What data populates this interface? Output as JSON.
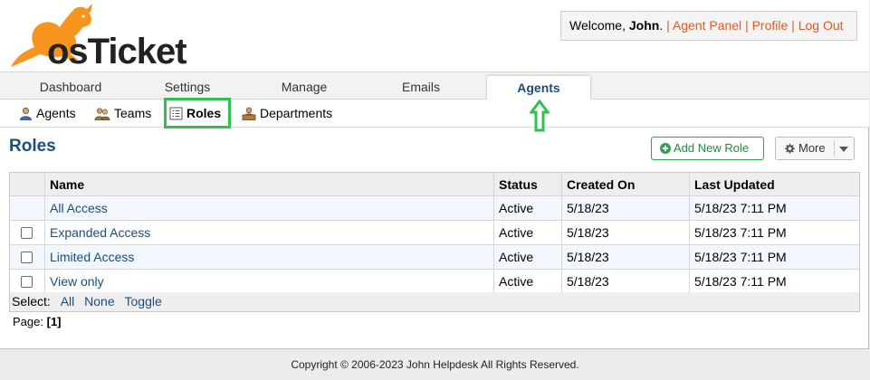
{
  "brand": {
    "logo_text": "osTicket"
  },
  "user_bar": {
    "welcome_prefix": "Welcome, ",
    "user_name": "John",
    "welcome_suffix": ".",
    "separator": "|",
    "links": [
      "Agent Panel",
      "Profile",
      "Log Out"
    ]
  },
  "nav": {
    "tabs": [
      "Dashboard",
      "Settings",
      "Manage",
      "Emails",
      "Agents"
    ],
    "active_tab": "Agents"
  },
  "subnav": {
    "items": [
      {
        "label": "Agents",
        "icon": "agent-icon"
      },
      {
        "label": "Teams",
        "icon": "teams-icon"
      },
      {
        "label": "Roles",
        "icon": "roles-icon"
      },
      {
        "label": "Departments",
        "icon": "departments-icon"
      }
    ],
    "active_item": "Roles"
  },
  "page": {
    "title": "Roles",
    "add_button_label": "Add New Role",
    "more_button_label": "More"
  },
  "table": {
    "columns": [
      "Name",
      "Status",
      "Created On",
      "Last Updated"
    ],
    "rows": [
      {
        "name": "All Access",
        "status": "Active",
        "created": "5/18/23",
        "updated": "5/18/23 7:11 PM",
        "checkbox": false
      },
      {
        "name": "Expanded Access",
        "status": "Active",
        "created": "5/18/23",
        "updated": "5/18/23 7:11 PM",
        "checkbox": true
      },
      {
        "name": "Limited Access",
        "status": "Active",
        "created": "5/18/23",
        "updated": "5/18/23 7:11 PM",
        "checkbox": true
      },
      {
        "name": "View only",
        "status": "Active",
        "created": "5/18/23",
        "updated": "5/18/23 7:11 PM",
        "checkbox": true
      }
    ]
  },
  "select_bar": {
    "label": "Select:",
    "all": "All",
    "none": "None",
    "toggle": "Toggle"
  },
  "pager": {
    "label": "Page:",
    "current": "[1]"
  },
  "footer": {
    "text": "Copyright © 2006-2023 John Helpdesk All Rights Reserved."
  },
  "colors": {
    "brand_orange": "#f7941d",
    "link_blue": "#184e81",
    "highlight_green": "#2fc050",
    "user_link_orange": "#e05a1f"
  }
}
